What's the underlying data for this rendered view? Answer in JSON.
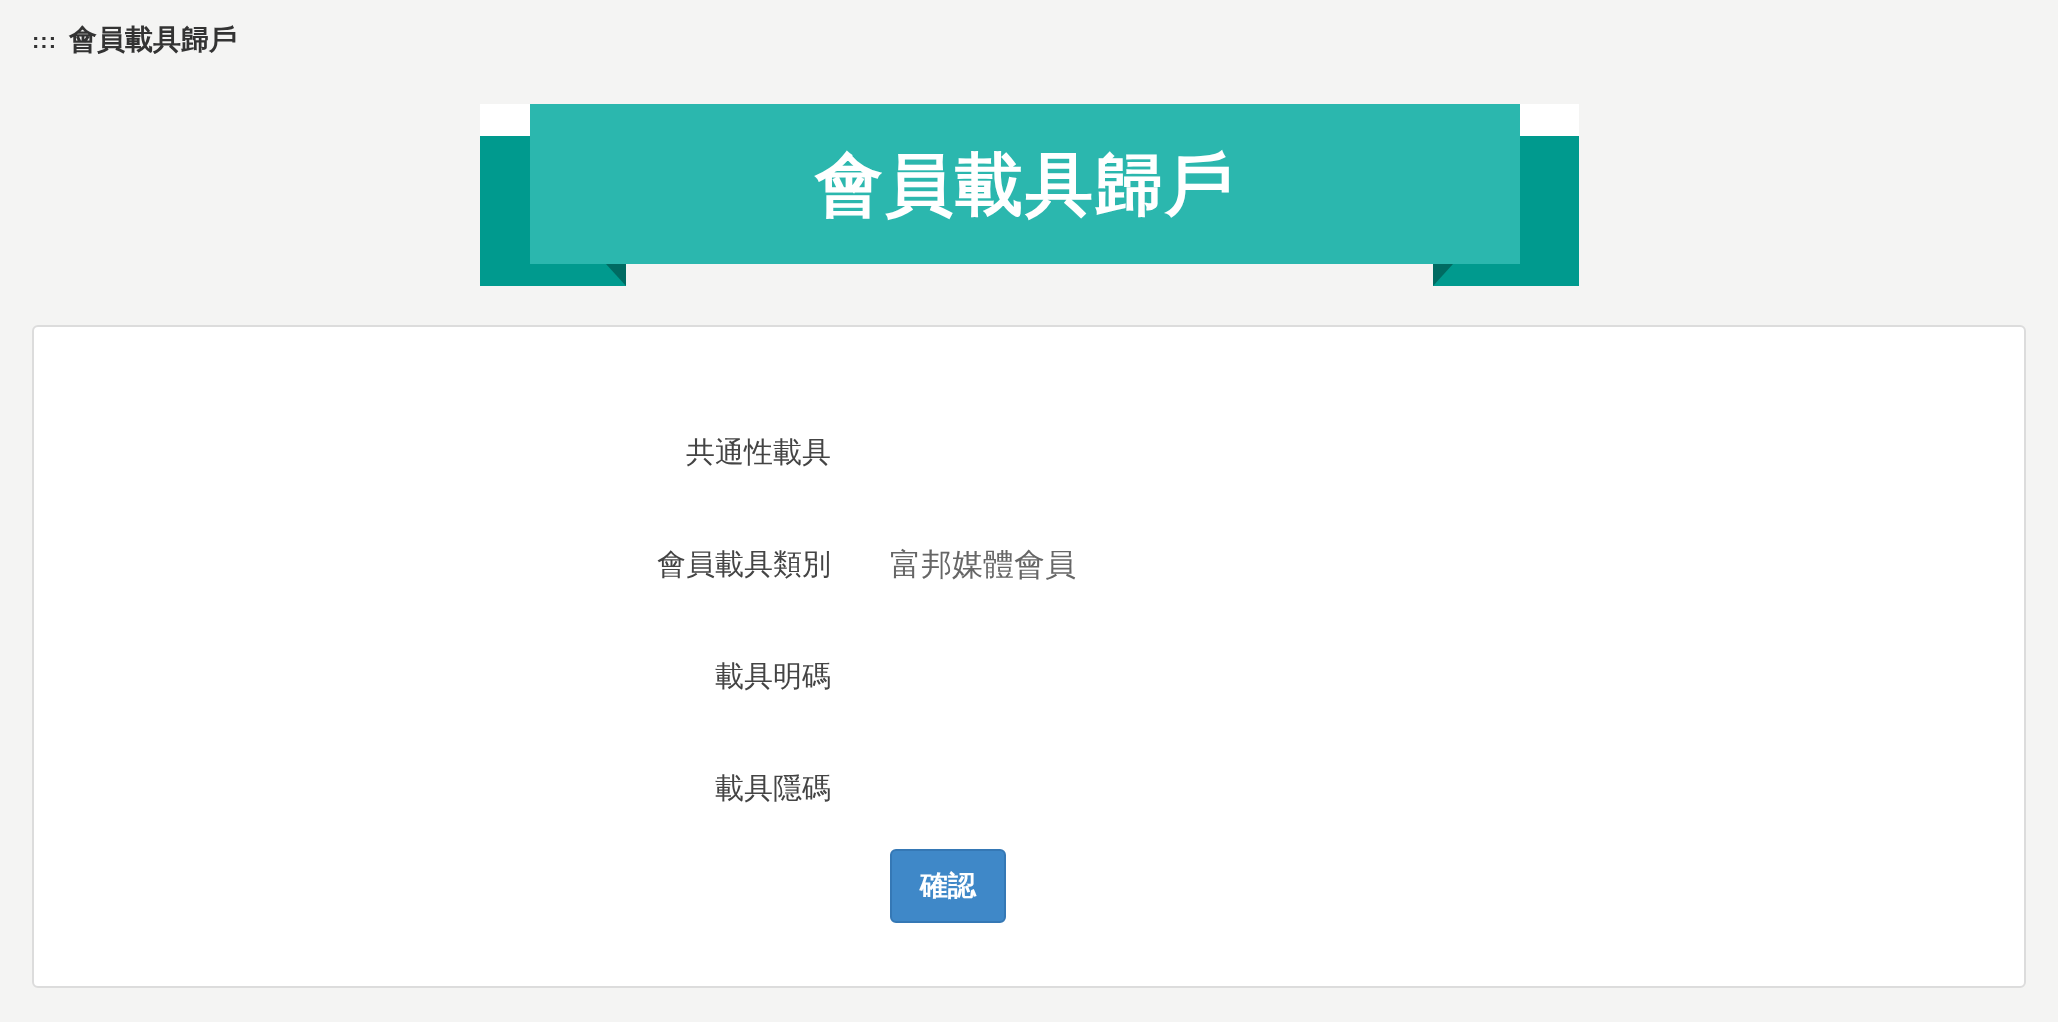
{
  "breadcrumb": {
    "icon": ":::",
    "title": "會員載具歸戶"
  },
  "banner": {
    "title": "會員載具歸戶"
  },
  "form": {
    "fields": [
      {
        "label": "共通性載具"
      },
      {
        "label": "會員載具類別",
        "value": "富邦媒體會員"
      },
      {
        "label": "載具明碼"
      },
      {
        "label": "載具隱碼"
      }
    ],
    "submit": "確認"
  }
}
